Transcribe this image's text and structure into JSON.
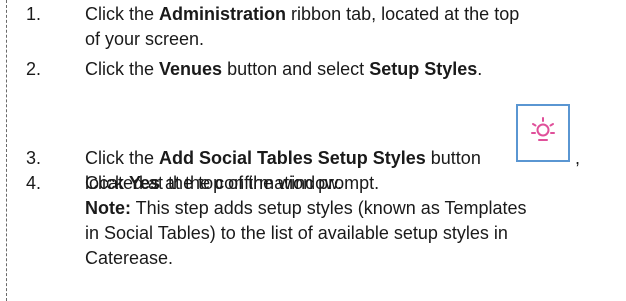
{
  "steps": [
    {
      "number": "1.",
      "line1_pre": "Click the ",
      "line1_bold": "Administration",
      "line1_post": " ribbon tab, located at the top",
      "line2": "of your screen."
    },
    {
      "number": "2.",
      "pre": "Click the ",
      "bold1": "Venues",
      "mid": " button and select ",
      "bold2": "Setup Styles",
      "post": "."
    },
    {
      "number": "3.",
      "pre": "Click the ",
      "bold": "Add Social Tables Setup Styles",
      "post": " button",
      "after_icon": ",",
      "icon": "sun-icon",
      "line2": "located at the top of the window."
    },
    {
      "number": "4.",
      "pre": "Click ",
      "bold": "Yes",
      "post": " at the confirmation prompt.",
      "note_label": "Note:",
      "note_lines": [
        " This step adds setup styles (known as Templates",
        "in Social Tables) to the list of available setup styles in",
        "Caterease."
      ]
    }
  ],
  "colors": {
    "icon_border": "#5a96d2",
    "icon_glyph": "#e0509a",
    "text": "#1a1a1a"
  }
}
